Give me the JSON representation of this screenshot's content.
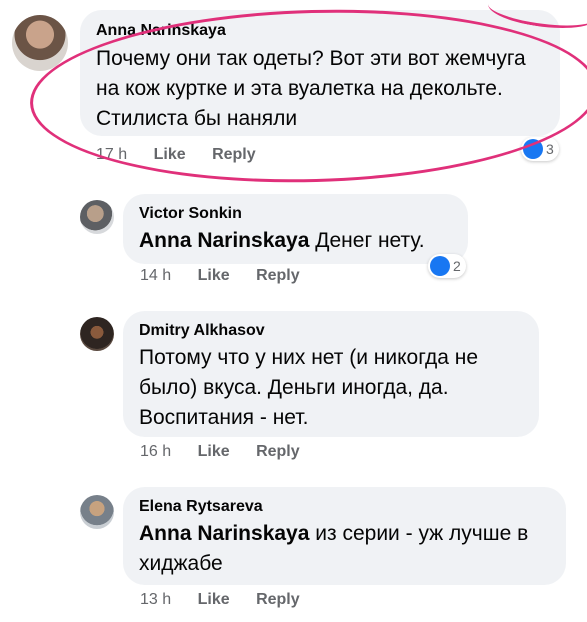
{
  "comments": [
    {
      "author": "Anna Narinskaya",
      "mention": "",
      "text": "Почему они так одеты? Вот эти вот жемчуга на кож куртке и эта вуалетка на декольте. Стилиста бы наняли",
      "time": "17 h",
      "like_label": "Like",
      "reply_label": "Reply",
      "reaction_count": "3",
      "highlighted": true
    },
    {
      "author": "Victor Sonkin",
      "mention": "Anna Narinskaya",
      "text": "Денег нету.",
      "time": "14 h",
      "like_label": "Like",
      "reply_label": "Reply",
      "reaction_count": "2"
    },
    {
      "author": "Dmitry Alkhasov",
      "mention": "",
      "text": "Потому что у них нет (и никогда не было) вкуса. Деньги иногда, да. Воспитания - нет.",
      "time": "16 h",
      "like_label": "Like",
      "reply_label": "Reply",
      "reaction_count": ""
    },
    {
      "author": "Elena Rytsareva",
      "mention": "Anna Narinskaya",
      "text": "из серии - уж лучше в хиджабе",
      "time": "13 h",
      "like_label": "Like",
      "reply_label": "Reply",
      "reaction_count": ""
    }
  ],
  "colors": {
    "bubble": "#f0f2f5",
    "meta_text": "#65676b",
    "like_blue": "#1877f2",
    "highlight_marker": "#e0307a"
  },
  "icons": {
    "reaction": "like-reaction-icon",
    "avatar": "avatar"
  }
}
